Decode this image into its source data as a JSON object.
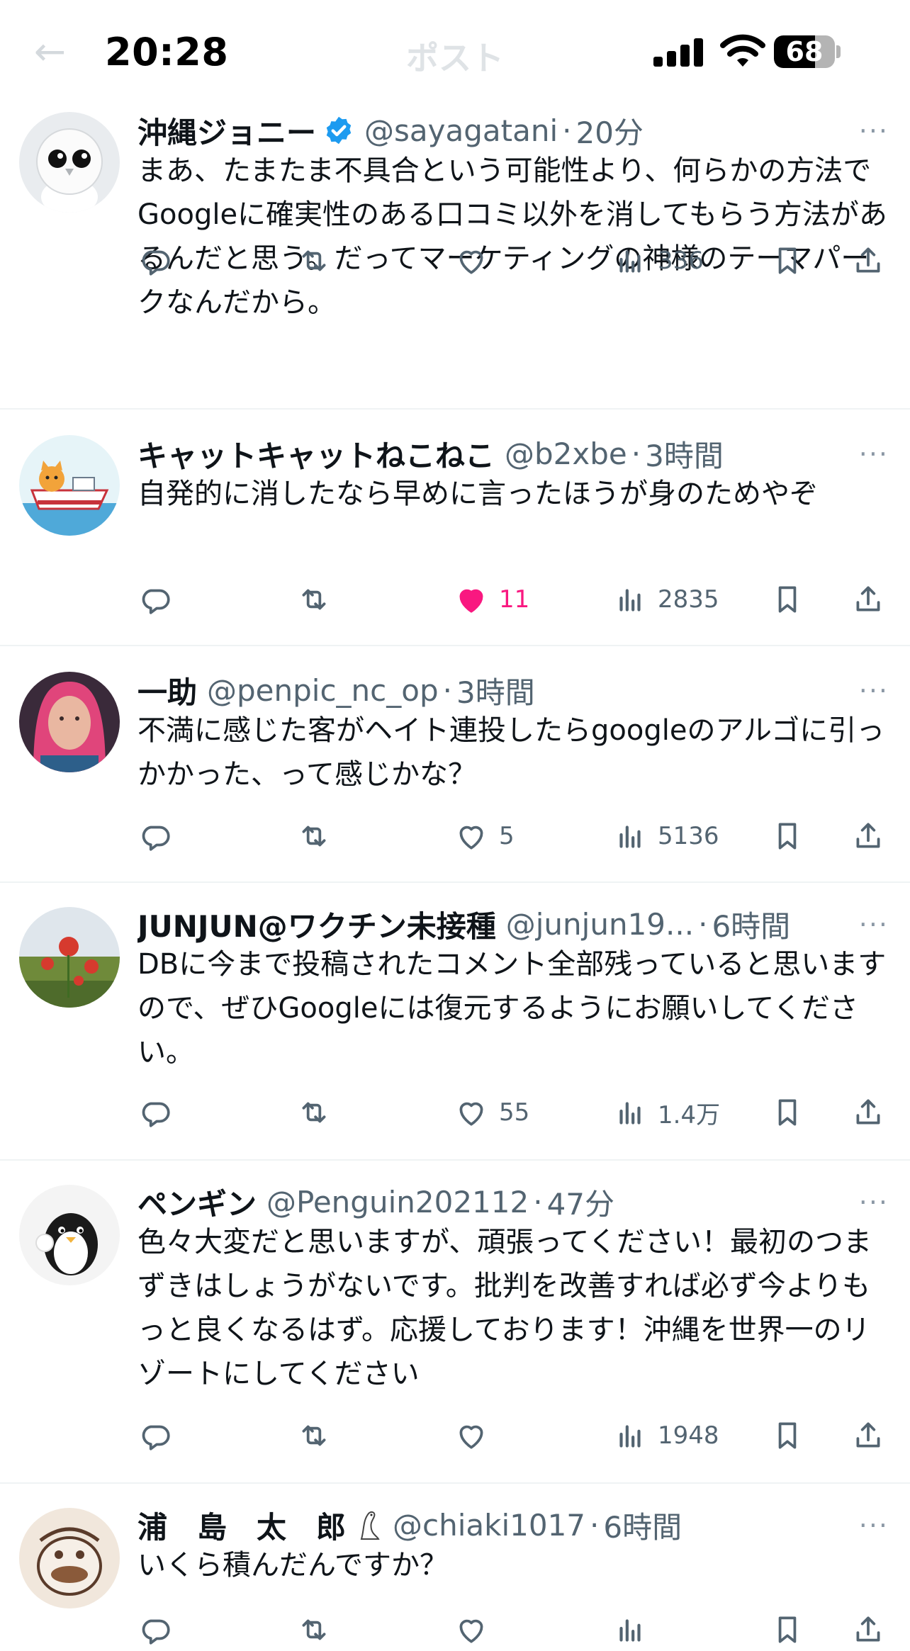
{
  "status_bar": {
    "time": "20:28",
    "battery": "68",
    "battery_fraction": 0.68
  },
  "nav": {
    "back_icon": "arrow-left-icon",
    "title": "ポスト"
  },
  "colors": {
    "text": "#0f1419",
    "muted": "#536471",
    "divider": "#eff3f4",
    "like_active": "#f91880",
    "verified": "#1d9bf0"
  },
  "tweets": [
    {
      "name": "沖縄ジョニー",
      "verified": true,
      "handle": "@sayagatani",
      "sep": "·",
      "time": "20分",
      "more": "···",
      "text": "まあ、たまたま不具合という可能性より、何らかの方法でGoogleに確実性のある口コミ以外を消してもらう方法があるんだと思う。だってマーケティングの神様のテーマパークなんだから。",
      "replies": "",
      "reposts": "",
      "likes": "",
      "liked": false,
      "views": "336"
    },
    {
      "name": "キャットキャットねこねこ",
      "verified": false,
      "handle": "@b2xbe",
      "sep": "·",
      "time": "3時間",
      "more": "···",
      "text": "自発的に消したなら早めに言ったほうが身のためやぞ",
      "replies": "",
      "reposts": "",
      "likes": "11",
      "liked": true,
      "views": "2835"
    },
    {
      "name": "一助",
      "verified": false,
      "handle": "@penpic_nc_op",
      "sep": "·",
      "time": "3時間",
      "more": "···",
      "text": "不満に感じた客がヘイト連投したらgoogleのアルゴに引っかかった、って感じかな？",
      "replies": "",
      "reposts": "",
      "likes": "5",
      "liked": false,
      "views": "5136"
    },
    {
      "name": "JUNJUN@ワクチン未接種",
      "verified": false,
      "handle": "@junjun19...",
      "sep": "·",
      "time": "6時間",
      "more": "···",
      "text": "DBに今まで投稿されたコメント全部残っていると思いますので、ぜひGoogleには復元するようにお願いしてください。",
      "replies": "",
      "reposts": "",
      "likes": "55",
      "liked": false,
      "views": "1.4万"
    },
    {
      "name": "ペンギン",
      "verified": false,
      "handle": "@Penguin202112",
      "sep": "·",
      "time": "47分",
      "more": "···",
      "text": "色々大変だと思いますが、頑張ってください！最初のつまずきはしょうがないです。批判を改善すれば必ず今よりもっと良くなるはず。応援しております！沖縄を世界一のリゾートにしてください",
      "replies": "",
      "reposts": "",
      "likes": "",
      "liked": false,
      "views": "1948"
    },
    {
      "name": "浦　島　太　郎",
      "verified": false,
      "handle": "@chiaki1017",
      "sep": "·",
      "time": "6時間",
      "more": "···",
      "text": "いくら積んだんですか？",
      "replies": "",
      "reposts": "",
      "likes": "",
      "liked": false,
      "views": ""
    }
  ]
}
